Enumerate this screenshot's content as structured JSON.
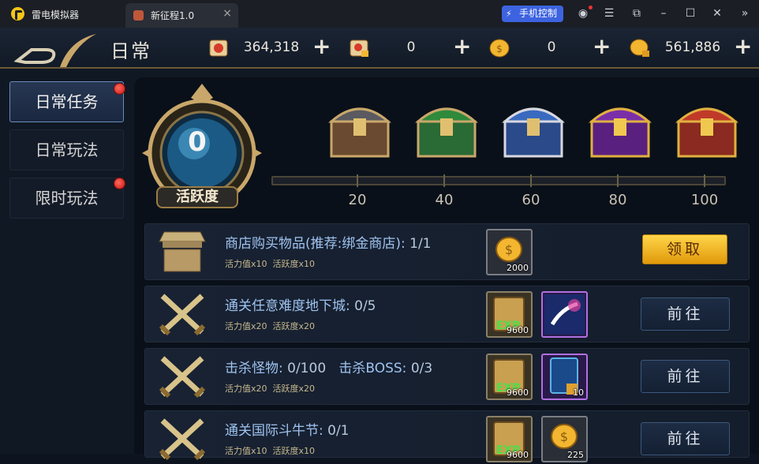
{
  "window": {
    "app_title": "雷电模拟器",
    "tab_label": "新征程1.0",
    "phone_control_label": "手机控制",
    "icons": [
      "account-icon",
      "menu-icon",
      "popout-icon",
      "minimize-icon",
      "maximize-icon",
      "close-icon",
      "collapse-icon"
    ]
  },
  "game": {
    "page_title": "日常",
    "resources": [
      {
        "icon": "scroll-token-icon",
        "value": "364,318"
      },
      {
        "icon": "locked-scroll-token-icon",
        "value": "0"
      },
      {
        "icon": "gold-coin-icon",
        "value": "0"
      },
      {
        "icon": "locked-gold-coin-icon",
        "value": "561,886"
      }
    ],
    "sidebar": [
      {
        "label": "日常任务",
        "active": true,
        "badge": true
      },
      {
        "label": "日常玩法",
        "active": false,
        "badge": false
      },
      {
        "label": "限时玩法",
        "active": false,
        "badge": true
      }
    ],
    "activity": {
      "value": "0",
      "label": "活跃度",
      "progress": 0,
      "milestones": [
        "20",
        "40",
        "60",
        "80",
        "100"
      ],
      "chest_colors": [
        "#8a6a3c",
        "#2f8a3c",
        "#3a6ac0",
        "#7a2fa8",
        "#c03a2a"
      ]
    },
    "tasks": [
      {
        "icon": "shop-stall-icon",
        "title": "商店购买物品(推荐:绑金商店):",
        "progress": "1/1",
        "vitality_label": "活力值",
        "vitality_mult": "x10",
        "activity_label": "活跃度",
        "activity_mult": "x10",
        "rewards": [
          {
            "icon": "gold-coin-icon",
            "qty": "2000"
          }
        ],
        "action": "领取",
        "action_type": "claim"
      },
      {
        "icon": "crossed-swords-icon",
        "title": "通关任意难度地下城:",
        "progress": "0/5",
        "vitality_label": "活力值",
        "vitality_mult": "x20",
        "activity_label": "活跃度",
        "activity_mult": "x20",
        "rewards": [
          {
            "icon": "exp-scroll-icon",
            "qty": "9600"
          },
          {
            "icon": "magic-hand-icon",
            "qty": ""
          }
        ],
        "action": "前往",
        "action_type": "go"
      },
      {
        "icon": "crossed-swords-icon",
        "title": "击杀怪物:",
        "progress": "0/100",
        "title2": "击杀BOSS:",
        "progress2": "0/3",
        "vitality_label": "活力值",
        "vitality_mult": "x20",
        "activity_label": "活跃度",
        "activity_mult": "x20",
        "rewards": [
          {
            "icon": "exp-scroll-icon",
            "qty": "9600"
          },
          {
            "icon": "locked-spell-card-icon",
            "qty": "10"
          }
        ],
        "action": "前往",
        "action_type": "go"
      },
      {
        "icon": "crossed-swords-icon",
        "title": "通关国际斗牛节:",
        "progress": "0/1",
        "vitality_label": "活力值",
        "vitality_mult": "x10",
        "activity_label": "活跃度",
        "activity_mult": "x10",
        "rewards": [
          {
            "icon": "exp-scroll-icon",
            "qty": "9600"
          },
          {
            "icon": "gold-coin-icon",
            "qty": "225"
          }
        ],
        "action": "前往",
        "action_type": "go"
      }
    ]
  }
}
